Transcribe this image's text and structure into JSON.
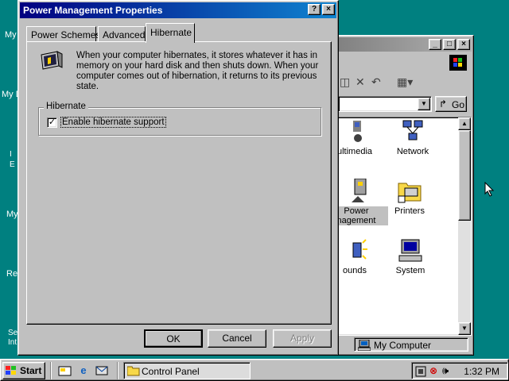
{
  "desktop": {
    "icon_labels": [
      "My",
      "My D",
      "I\nE",
      "My",
      "Re",
      "Se\nInt"
    ]
  },
  "control_panel": {
    "address_go": "Go",
    "items": [
      {
        "label": "ultimedia",
        "icon": "multimedia-icon"
      },
      {
        "label": "Network",
        "icon": "network-icon"
      },
      {
        "label": "Power\nManagement",
        "label_line1": "Power",
        "label_line2": "nagement",
        "icon": "power-management-icon"
      },
      {
        "label": "Printers",
        "icon": "printers-folder-icon"
      },
      {
        "label": "ounds",
        "icon": "sounds-icon"
      },
      {
        "label": "System",
        "icon": "system-icon"
      }
    ],
    "status": "My Computer"
  },
  "dialog": {
    "title": "Power Management Properties",
    "help_button": "?",
    "close_button": "×",
    "tabs": [
      {
        "label": "Power Schemes"
      },
      {
        "label": "Advanced"
      },
      {
        "label": "Hibernate",
        "active": true
      }
    ],
    "description": "When your computer hibernates, it stores whatever it has in memory on your hard disk and then shuts down. When your computer comes out of hibernation, it returns to its previous state.",
    "group_label": "Hibernate",
    "checkbox_label": "Enable hibernate support",
    "checkbox_checked": true,
    "ok": "OK",
    "cancel": "Cancel",
    "apply": "Apply"
  },
  "taskbar": {
    "start": "Start",
    "task": "Control Panel",
    "clock": "1:32 PM"
  }
}
